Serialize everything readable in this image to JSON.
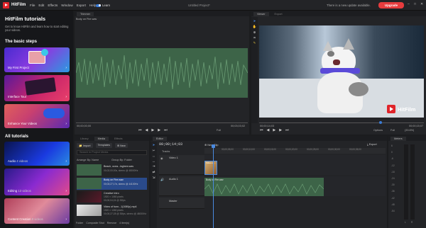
{
  "app": {
    "name": "HitFilm",
    "menu": [
      "File",
      "Edit",
      "Effects",
      "Window",
      "Export",
      "Help"
    ],
    "learn_label": "Learn",
    "project_title": "Untitled Project*",
    "update_notice": "There is a new update available.",
    "upgrade_label": "Upgrade"
  },
  "left": {
    "title": "HitFilm tutorials",
    "desc": "Get to know HitFilm and learn how to start editing your videos.",
    "basic_title": "The basic steps",
    "cards": [
      {
        "label": "My First Project"
      },
      {
        "label": "Interface Tour"
      },
      {
        "label": "Enhance Your Videos"
      }
    ],
    "all_title": "All tutorials",
    "tutorials": [
      {
        "label": "Audio",
        "count": "4 videos"
      },
      {
        "label": "Editing",
        "count": "13 videos"
      },
      {
        "label": "Content Creation",
        "count": "9 videos"
      }
    ]
  },
  "trimmer": {
    "tab": "Trimmer",
    "clip": "Body on Fire.wav",
    "tc_start": "00;00;00;00",
    "tc_end": "00;03;03;02",
    "full": "Full"
  },
  "viewer": {
    "tab": "Viewer",
    "tab2": "Export",
    "tc_start": "00;00;14;03",
    "tc_end": "00;00;15;07",
    "options": "Options",
    "full": "Full",
    "zoom": "(33.6%)",
    "watermark": "HitFilm"
  },
  "media": {
    "tabs": [
      "Library",
      "Media",
      "Effects"
    ],
    "import": "Import",
    "templates": "Templates",
    "new": "New",
    "search_placeholder": "Search in Project Media",
    "arrange": "Arrange By: Name",
    "group": "Group By: Folder",
    "items": [
      {
        "name": "Beach, ocea...inghem.wav",
        "info": "00;02;00;00s, stereo @ 48000Hz"
      },
      {
        "name": "Body on Fire.wav",
        "info": "00;03;27;1?s, stereo @ 44100Hz"
      },
      {
        "name": "Creative Intro",
        "info": "1920 × 1080 pixels",
        "info2": "00;00;04;24 @ 30fps"
      },
      {
        "name": "Creative Intro",
        "info": "1920 × 1080 pixels",
        "info2": "00;00;04;24 @ 30fps"
      },
      {
        "name": "Video of funn...1(1080p).mp4",
        "info": "1920 × 1080 pixels",
        "info2": "00;00;27;28 @ 30fps, stereo @ 48000Hz"
      }
    ],
    "footer": [
      "Folder",
      "Composite Shot",
      "Remove",
      "4 item(s)"
    ]
  },
  "editor": {
    "tab": "Editor",
    "timecode": "00;00;14;03",
    "new_clip": "New Clip",
    "export": "Export",
    "tracks_label": "Tracks",
    "ruler": [
      "00;00;05;00",
      "00;00;10;00",
      "00;00;15;00",
      "00;00;20;00",
      "00;00;25;00",
      "00;00;30;00",
      "00;00;35;00",
      "00;00;40;00"
    ],
    "video_track": "Video 1",
    "audio_track": "Audio 1",
    "master": "Master",
    "audio_clip": "Body on Fire.wav",
    "video_clip": "Video of..."
  },
  "meters": {
    "tab": "Meters",
    "labels": [
      "6",
      "0",
      "-6",
      "-12",
      "-18",
      "-24",
      "-30",
      "-36",
      "-42",
      "-48",
      "-54"
    ],
    "lr": [
      "L",
      "R"
    ]
  },
  "colors": {
    "accent": "#e73c3e",
    "blue": "#3a7bd5",
    "wave": "#4d7a58"
  }
}
